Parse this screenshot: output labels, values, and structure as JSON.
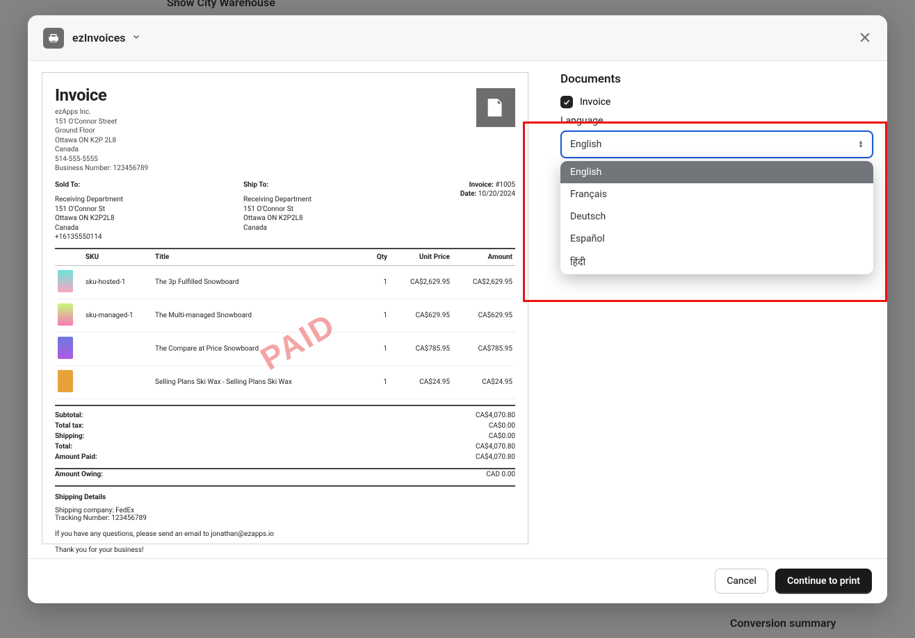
{
  "background": {
    "line1": "Snow City Warehouse",
    "line2": "Conversion summary"
  },
  "modal": {
    "app_title": "ezInvoices",
    "close_label": "Close"
  },
  "invoice": {
    "title": "Invoice",
    "company": {
      "name": "ezApps Inc.",
      "addr1": "151 O'Connor Street",
      "addr2": "Ground Floor",
      "city": "Ottawa ON K2P 2L8",
      "country": "Canada",
      "phone": "514-555-5555",
      "biz": "Business Number: 123456789"
    },
    "sold_to_label": "Sold To:",
    "ship_to_label": "Ship To:",
    "sold_to": {
      "l1": "Receiving Department",
      "l2": "151 O'Connor St",
      "l3": "Ottawa ON K2P2L8",
      "l4": "Canada",
      "l5": "+16135550114"
    },
    "ship_to": {
      "l1": "Receiving Department",
      "l2": "151 O'Connor St",
      "l3": "Ottawa ON K2P2L8",
      "l4": "Canada"
    },
    "meta": {
      "inv_label": "Invoice:",
      "inv_no": "#1005",
      "date_label": "Date:",
      "date": "10/20/2024"
    },
    "cols": {
      "sku": "SKU",
      "title": "Title",
      "qty": "Qty",
      "unit": "Unit Price",
      "amount": "Amount"
    },
    "items": [
      {
        "sku": "sku-hosted-1",
        "title": "The 3p Fulfilled Snowboard",
        "qty": "1",
        "unit": "CA$2,629.95",
        "amount": "CA$2,629.95",
        "thumb": "linear-gradient(#6fe2d6,#f7a6c4)"
      },
      {
        "sku": "sku-managed-1",
        "title": "The Multi-managed Snowboard",
        "qty": "1",
        "unit": "CA$629.95",
        "amount": "CA$629.95",
        "thumb": "linear-gradient(#c7f77a,#f77ab5)"
      },
      {
        "sku": "",
        "title": "The Compare at Price Snowboard",
        "qty": "1",
        "unit": "CA$785.95",
        "amount": "CA$785.95",
        "thumb": "linear-gradient(#6a7be0,#b05ae0)"
      },
      {
        "sku": "",
        "title": "Selling Plans Ski Wax - Selling Plans Ski Wax",
        "qty": "1",
        "unit": "CA$24.95",
        "amount": "CA$24.95",
        "thumb": "#e8a23a"
      }
    ],
    "totals": {
      "subtotal_l": "Subtotal:",
      "subtotal_v": "CA$4,070.80",
      "tax_l": "Total tax:",
      "tax_v": "CA$0.00",
      "ship_l": "Shipping:",
      "ship_v": "CA$0.00",
      "total_l": "Total:",
      "total_v": "CA$4,070.80",
      "paid_l": "Amount Paid:",
      "paid_v": "CA$4,070.80",
      "owing_l": "Amount Owing:",
      "owing_v": "CAD 0.00"
    },
    "paid_stamp": "PAID",
    "shipping_details": {
      "heading": "Shipping Details",
      "l1": "Shipping company: FedEx",
      "l2": "Tracking Number: 123456789"
    },
    "note1": "If you have any questions, please send an email to jonathan@ezapps.io",
    "note2": "Thank you for your business!"
  },
  "side": {
    "documents_label": "Documents",
    "invoice_checkbox_label": "Invoice",
    "language_label": "Language",
    "selected_language": "English",
    "options": [
      "English",
      "Français",
      "Deutsch",
      "Español",
      "हिंदी"
    ]
  },
  "footer": {
    "cancel": "Cancel",
    "continue": "Continue to print"
  }
}
